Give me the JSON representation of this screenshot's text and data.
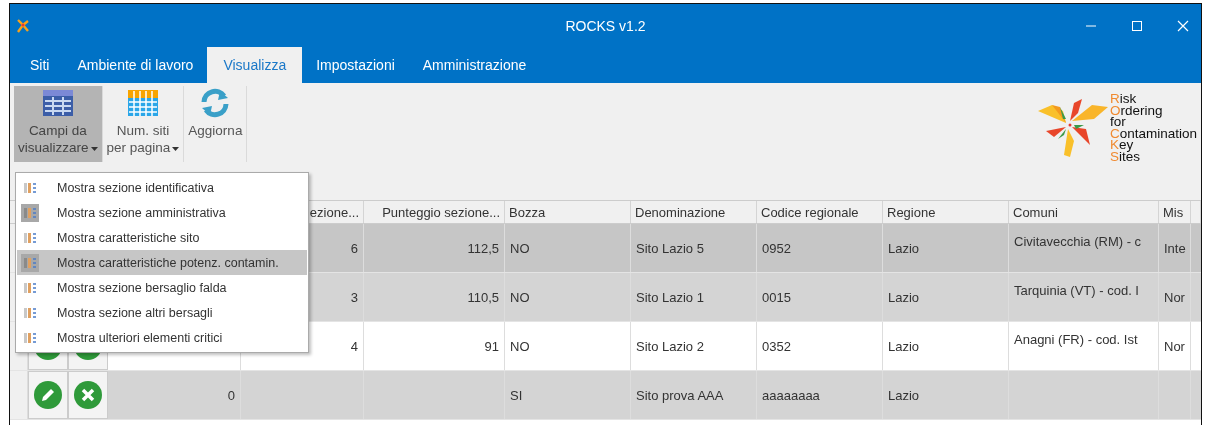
{
  "window": {
    "title": "ROCKS  v1.2"
  },
  "tabs": [
    {
      "label": "Siti",
      "selected": false
    },
    {
      "label": "Ambiente di lavoro",
      "selected": false
    },
    {
      "label": "Visualizza",
      "selected": true
    },
    {
      "label": "Impostazioni",
      "selected": false
    },
    {
      "label": "Amministrazione",
      "selected": false
    }
  ],
  "ribbon": [
    {
      "kind": "table",
      "lines": [
        "Campi da",
        "visualizzare"
      ],
      "dropdown": true,
      "selected": true
    },
    {
      "kind": "grid",
      "lines": [
        "Num. siti",
        "per pagina"
      ],
      "dropdown": true,
      "selected": false
    },
    {
      "kind": "refresh",
      "lines": [
        "Aggiorna"
      ],
      "dropdown": false,
      "selected": false
    }
  ],
  "logo": {
    "lines": [
      {
        "initial": "R",
        "rest": "isk"
      },
      {
        "initial": "O",
        "rest": "rdering"
      },
      {
        "rest": "for"
      },
      {
        "initial": "C",
        "rest": "ontamination"
      },
      {
        "initial": "K",
        "rest": "ey"
      },
      {
        "initial": "S",
        "rest": "ites"
      }
    ]
  },
  "menu": {
    "items": [
      {
        "label": "Mostra sezione identificativa",
        "checked": false,
        "selected": false
      },
      {
        "label": "Mostra sezione amministrativa",
        "checked": true,
        "selected": false
      },
      {
        "label": "Mostra caratteristiche sito",
        "checked": false,
        "selected": false
      },
      {
        "label": "Mostra caratteristiche potenz. contamin.",
        "checked": true,
        "selected": true
      },
      {
        "label": "Mostra sezione bersaglio falda",
        "checked": false,
        "selected": false
      },
      {
        "label": "Mostra sezione altri bersagli",
        "checked": false,
        "selected": false
      },
      {
        "label": "Mostra ulteriori elementi critici",
        "checked": false,
        "selected": false
      }
    ]
  },
  "table": {
    "columns": [
      {
        "kind": "number"
      },
      {
        "kind": "number",
        "label": "ezione..."
      },
      {
        "kind": "number",
        "label": "Punteggio sezione..."
      },
      {
        "kind": "text",
        "label": "Bozza"
      },
      {
        "kind": "text",
        "label": "Denominazione"
      },
      {
        "kind": "text",
        "label": "Codice regionale"
      },
      {
        "kind": "text",
        "label": "Regione"
      },
      {
        "kind": "top",
        "label": "Comuni"
      },
      {
        "kind": "text",
        "label": "Mis"
      }
    ],
    "rows": [
      {
        "selected": true,
        "cells": [
          null,
          "6",
          "112,5",
          "NO",
          "Sito Lazio 5",
          "0952",
          "Lazio",
          "Civitavecchia (RM) - c",
          "Inte"
        ]
      },
      {
        "selected": false,
        "cells": [
          null,
          "3",
          "110,5",
          "NO",
          "Sito Lazio 1",
          "0015",
          "Lazio",
          "Tarquinia (VT) - cod. I",
          "Nor"
        ]
      },
      {
        "selected": false,
        "cells": [
          null,
          "4",
          "91",
          "NO",
          "Sito Lazio 2",
          "0352",
          "Lazio",
          "Anagni (FR) - cod. Ist",
          "Nor"
        ]
      },
      {
        "selected": false,
        "cells": [
          "0",
          null,
          null,
          "SI",
          "Sito prova AAA",
          "aaaaaaaa",
          "Lazio",
          null,
          null
        ]
      }
    ]
  }
}
